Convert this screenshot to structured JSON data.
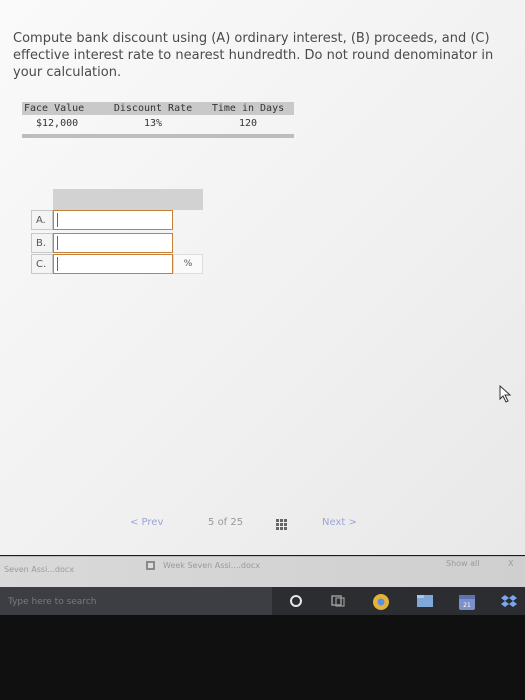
{
  "question": {
    "text": "Compute bank discount using (A) ordinary interest, (B) proceeds, and (C) effective interest rate to nearest hundredth. Do not round denominator in your calculation."
  },
  "given_table": {
    "headers": [
      "Face Value",
      "Discount Rate",
      "Time in Days"
    ],
    "row": [
      "$12,000",
      "13%",
      "120"
    ]
  },
  "answers": {
    "rows": [
      {
        "label": "A.",
        "value": ""
      },
      {
        "label": "B.",
        "value": ""
      },
      {
        "label": "C.",
        "value": ""
      }
    ],
    "c_suffix": "%"
  },
  "navigation": {
    "prev": "< Prev",
    "page_current": "5",
    "page_of": "of",
    "page_total": "25",
    "next": "Next >"
  },
  "downloads_bar": {
    "item1": "Seven Assi...docx",
    "item2": "Week Seven Assi....docx",
    "show_all": "Show all",
    "close": "X"
  },
  "taskbar": {
    "search_placeholder": "Type here to search",
    "calendar_badge": "21"
  },
  "colors": {
    "input_border": "#c7803a",
    "link": "#9aa6d6",
    "taskbar": "#2b2d31"
  }
}
